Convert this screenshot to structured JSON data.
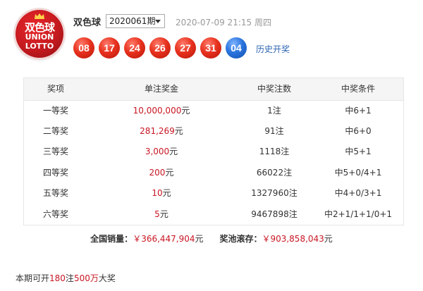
{
  "logo": {
    "text_cn": "双色球",
    "text_en_1": "UNION",
    "text_en_2": "LOTTO"
  },
  "header": {
    "game_name": "双色球",
    "issue": "2020061期",
    "draw_time": "2020-07-09 21:15 周四",
    "history_link": "历史开奖"
  },
  "balls": {
    "red": [
      "08",
      "17",
      "24",
      "26",
      "27",
      "31"
    ],
    "blue": [
      "04"
    ]
  },
  "colors": {
    "red_ball": "#e8321f",
    "blue_ball": "#2b74de",
    "money": "#c81623",
    "link": "#2d66b1"
  },
  "table": {
    "headers": [
      "奖项",
      "单注奖金",
      "中奖注数",
      "中奖条件"
    ],
    "rows": [
      {
        "level": "一等奖",
        "amount": "10,000,000",
        "unit": "元",
        "count": "1注",
        "condition": "中6+1"
      },
      {
        "level": "二等奖",
        "amount": "281,269",
        "unit": "元",
        "count": "91注",
        "condition": "中6+0"
      },
      {
        "level": "三等奖",
        "amount": "3,000",
        "unit": "元",
        "count": "1118注",
        "condition": "中5+1"
      },
      {
        "level": "四等奖",
        "amount": "200",
        "unit": "元",
        "count": "66022注",
        "condition": "中5+0/4+1"
      },
      {
        "level": "五等奖",
        "amount": "10",
        "unit": "元",
        "count": "1327960注",
        "condition": "中4+0/3+1"
      },
      {
        "level": "六等奖",
        "amount": "5",
        "unit": "元",
        "count": "9467898注",
        "condition": "中2+1/1+1/0+1"
      }
    ]
  },
  "sales": {
    "sales_label": "全国销量：",
    "sales_amount": "￥366,447,904",
    "pool_label": "奖池滚存：",
    "pool_amount": "￥903,858,043",
    "unit": "元"
  },
  "summary": {
    "prefix": "本期可开",
    "count": "180",
    "mid": "注",
    "amount": "500万",
    "suffix": "大奖"
  }
}
